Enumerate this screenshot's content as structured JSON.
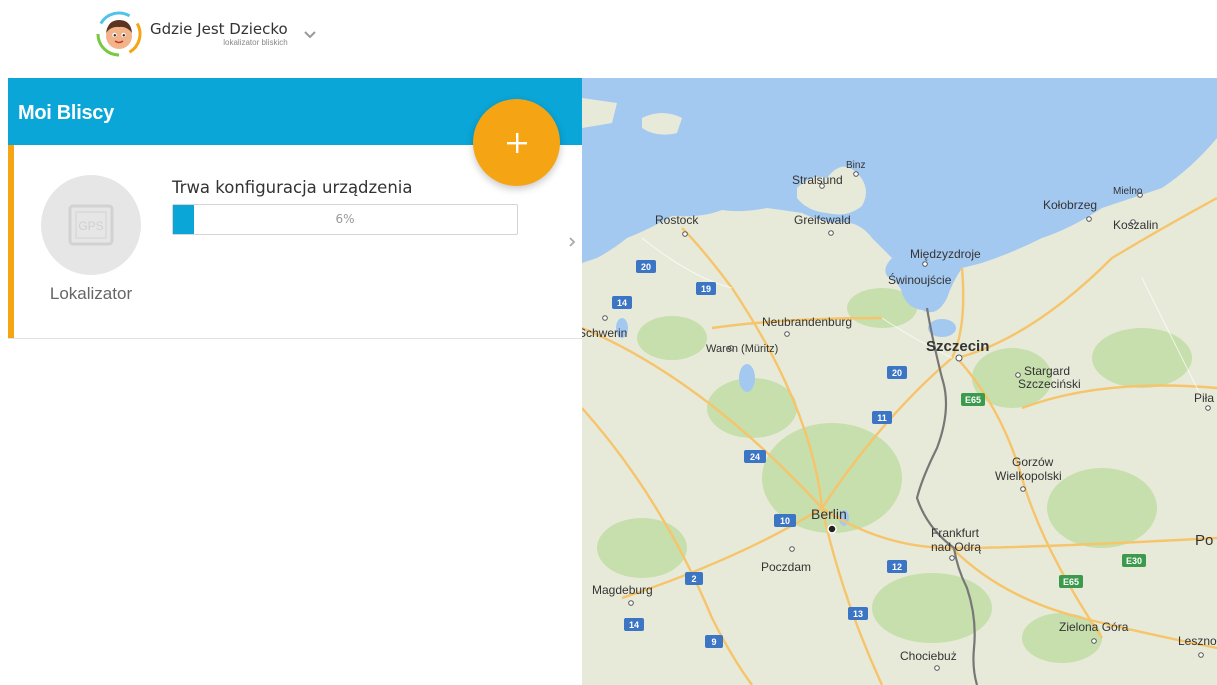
{
  "header": {
    "app_title": "Gdzie Jest Dziecko",
    "app_subtitle": "lokalizator bliskich"
  },
  "panel": {
    "title": "Moi Bliscy",
    "add_button_label": "+"
  },
  "device": {
    "name": "Lokalizator",
    "icon_text": "GPS",
    "status": "Trwa konfiguracja urządzenia",
    "progress_percent": 6,
    "progress_text": "6%"
  },
  "map": {
    "cities": [
      {
        "name": "Binz"
      },
      {
        "name": "Stralsund"
      },
      {
        "name": "Rostock"
      },
      {
        "name": "Greifswald"
      },
      {
        "name": "Mielno"
      },
      {
        "name": "Kołobrzeg"
      },
      {
        "name": "Koszalin"
      },
      {
        "name": "Międzyzdroje"
      },
      {
        "name": "Świnoujście"
      },
      {
        "name": "Neubrandenburg"
      },
      {
        "name": "Schwerin"
      },
      {
        "name": "Waren (Müritz)"
      },
      {
        "name": "Szczecin"
      },
      {
        "name": "Stargard"
      },
      {
        "name": "Szczeciński"
      },
      {
        "name": "Piła"
      },
      {
        "name": "Gorzów"
      },
      {
        "name": "Wielkopolski"
      },
      {
        "name": "Berlin"
      },
      {
        "name": "Frankfurt"
      },
      {
        "name": "nad Odrą"
      },
      {
        "name": "Poczdam"
      },
      {
        "name": "Magdeburg"
      },
      {
        "name": "Zielona Góra"
      },
      {
        "name": "Leszno"
      },
      {
        "name": "Chociebuż"
      },
      {
        "name": "Po"
      }
    ],
    "road_shields": [
      {
        "label": "20"
      },
      {
        "label": "19"
      },
      {
        "label": "14"
      },
      {
        "label": "20"
      },
      {
        "label": "11"
      },
      {
        "label": "24"
      },
      {
        "label": "10"
      },
      {
        "label": "2"
      },
      {
        "label": "12"
      },
      {
        "label": "14"
      },
      {
        "label": "9"
      },
      {
        "label": "13"
      },
      {
        "label": "E65"
      },
      {
        "label": "E30"
      },
      {
        "label": "E65"
      }
    ],
    "colors": {
      "sea": "#a4c9f1",
      "land": "#e8ead9",
      "forest": "#c6dfad",
      "road": "#f6c46a",
      "border": "#777777"
    }
  }
}
